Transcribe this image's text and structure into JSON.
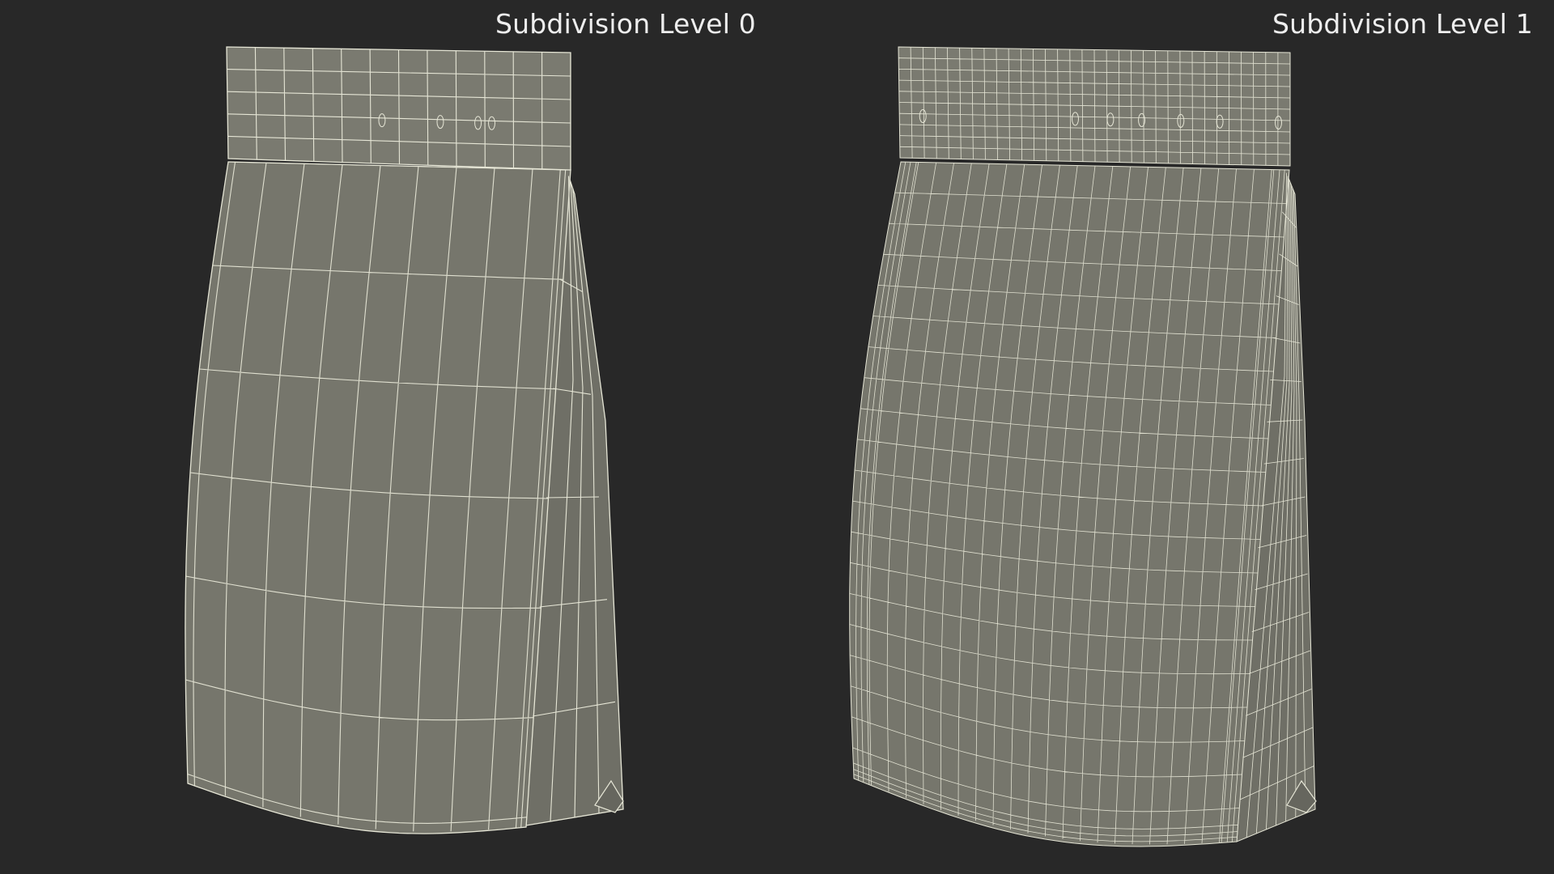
{
  "viewports": [
    {
      "id": "left",
      "label": "Subdivision Level 0",
      "subdivision_level": 0
    },
    {
      "id": "right",
      "label": "Subdivision Level 1",
      "subdivision_level": 1
    }
  ],
  "colors": {
    "background": "#282828",
    "front_face": "#76766c",
    "side_face": "#6f6f66",
    "wire": "#e6e6d6",
    "label": "#eeeeee"
  }
}
